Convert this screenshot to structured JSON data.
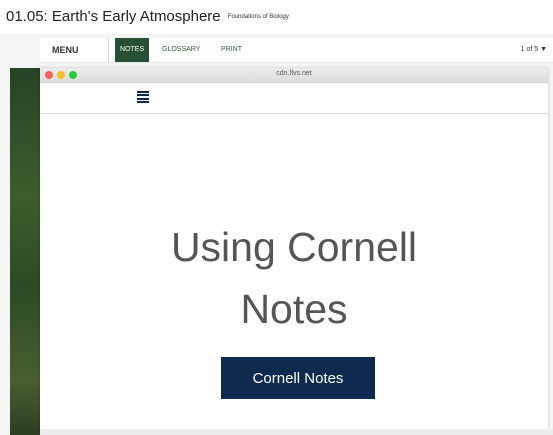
{
  "header": {
    "title": "01.05: Earth's Early Atmosphere",
    "subtitle": "Foundations of Biology"
  },
  "nav": {
    "menu_label": "MENU",
    "tabs": [
      {
        "label": "NOTES",
        "active": true
      },
      {
        "label": "GLOSSARY",
        "active": false
      },
      {
        "label": "PRINT",
        "active": false
      }
    ],
    "page_counter": "1 of 5 ▼"
  },
  "browser": {
    "url": "cdn.flvs.net"
  },
  "slide": {
    "title_line1": "Using Cornell",
    "title_line2": "Notes",
    "button_label": "Cornell Notes"
  },
  "colors": {
    "nav_active": "#264f33",
    "button_bg": "#0f2a4f",
    "title_text": "#555555"
  },
  "icons": [
    "menu-icon",
    "close-dot",
    "minimize-dot",
    "maximize-dot"
  ]
}
